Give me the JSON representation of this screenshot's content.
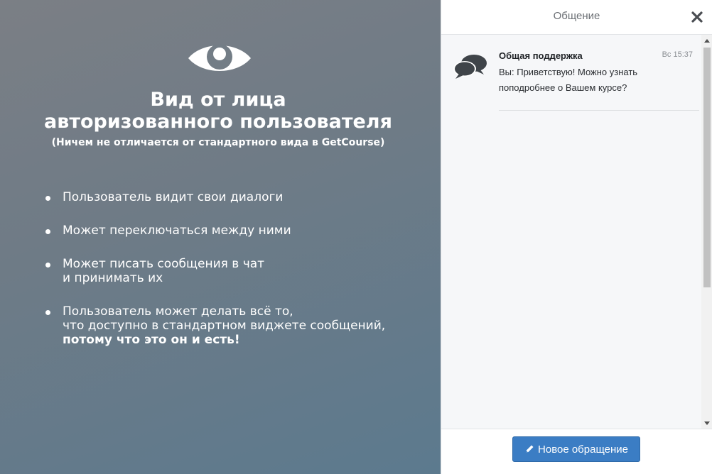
{
  "promo": {
    "title_line1": "Вид от лица",
    "title_line2": "авторизованного пользователя",
    "subtitle": "(Ничем не отличается от стандартного вида в GetCourse)",
    "bullets": [
      {
        "lines": [
          "Пользователь видит свои диалоги"
        ]
      },
      {
        "lines": [
          "Может переключаться между ними"
        ]
      },
      {
        "lines": [
          "Может писать сообщения в чат",
          "и принимать их"
        ]
      },
      {
        "lines": [
          "Пользователь может делать всё то,",
          "что доступно в стандартном виджете сообщений,"
        ],
        "strong": "потому что это он и есть!"
      }
    ],
    "icon": "eye-icon"
  },
  "chat": {
    "title": "Общение",
    "close_icon": "close-icon",
    "dialogs": [
      {
        "name": "Общая поддержка",
        "time": "Вс 15:37",
        "text": "Вы: Приветствую! Можно узнать поподробнее о Вашем курсе?",
        "icon": "chat-bubbles-icon"
      }
    ],
    "new_button_label": "Новое обращение",
    "new_button_icon": "pencil-icon"
  },
  "colors": {
    "accent": "#3b7dc4",
    "panel_bg": "#f6f7f9"
  }
}
